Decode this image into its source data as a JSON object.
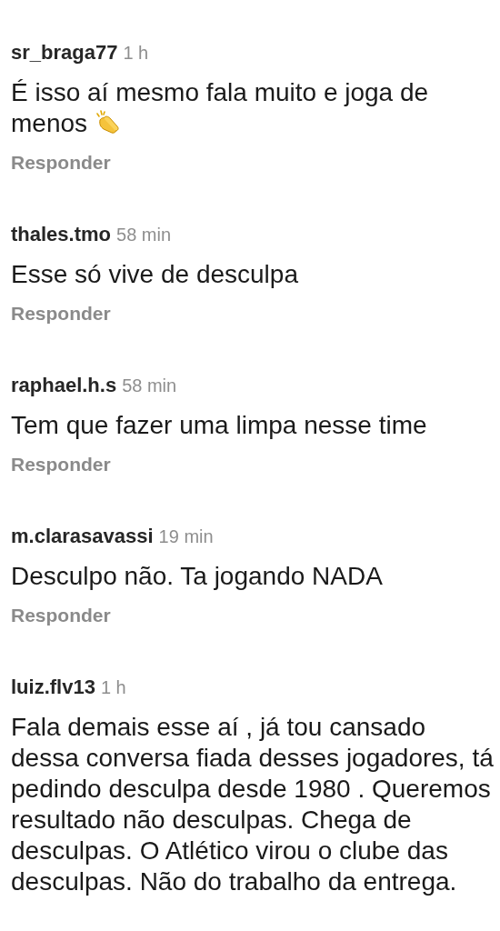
{
  "comments": [
    {
      "username": "sr_braga77",
      "time": "1 h",
      "text": "É isso aí mesmo fala muito e joga de menos",
      "clap": true,
      "reply": "Responder"
    },
    {
      "username": "thales.tmo",
      "time": "58 min",
      "text": "Esse só vive de desculpa",
      "clap": false,
      "reply": "Responder"
    },
    {
      "username": "raphael.h.s",
      "time": "58 min",
      "text": "Tem que fazer uma limpa nesse time",
      "clap": false,
      "reply": "Responder"
    },
    {
      "username": "m.clarasavassi",
      "time": "19 min",
      "text": "Desculpo não. Ta jogando NADA",
      "clap": false,
      "reply": "Responder"
    },
    {
      "username": "luiz.flv13",
      "time": "1 h",
      "text": "Fala demais esse aí , já tou cansado dessa conversa fiada desses jogadores, tá pedindo desculpa desde 1980 . Queremos resultado não desculpas. Chega de desculpas. O Atlético virou o clube das desculpas. Não do trabalho da entrega.",
      "clap": false
    }
  ]
}
